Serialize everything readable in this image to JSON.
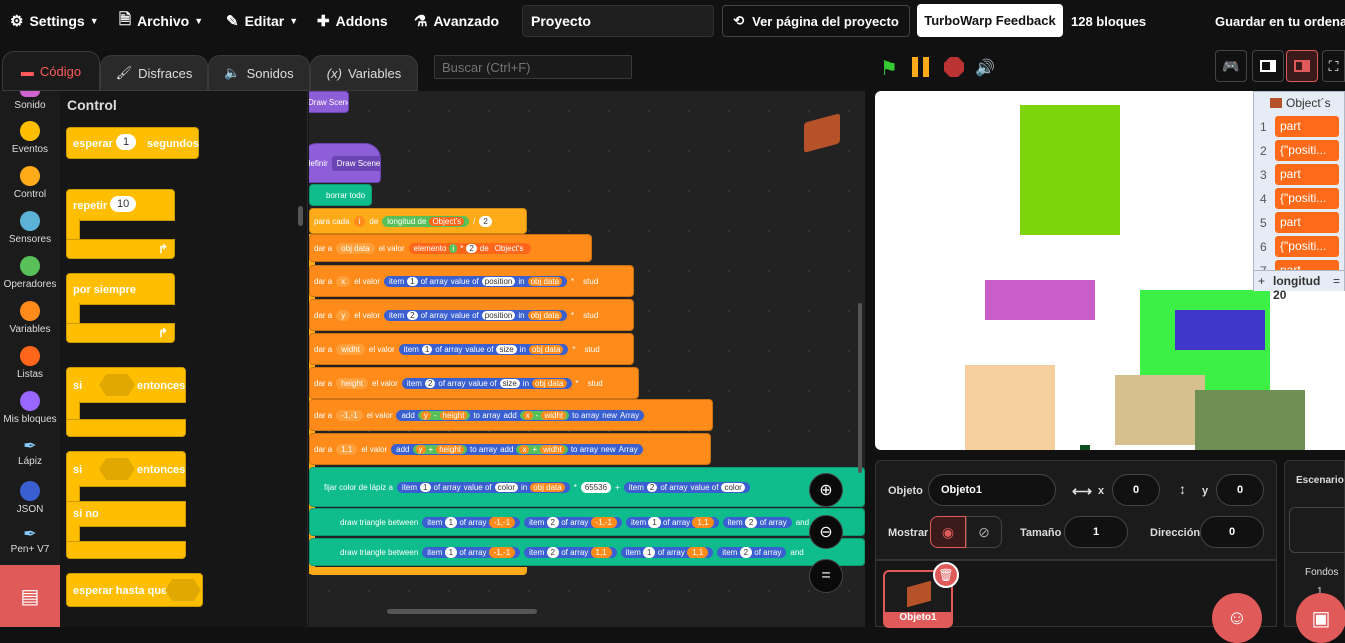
{
  "menu": {
    "settings": "Settings",
    "file": "Archivo",
    "edit": "Editar",
    "addons": "Addons",
    "advanced": "Avanzado",
    "project_title": "Proyecto",
    "see_project": "Ver página del proyecto",
    "feedback": "TurboWarp Feedback",
    "block_count": "128 bloques",
    "save": "Guardar en tu ordenado"
  },
  "tabs": {
    "code": "Código",
    "costumes": "Disfraces",
    "sounds": "Sonidos",
    "variables": "Variables"
  },
  "search": {
    "placeholder": "Buscar (Ctrl+F)"
  },
  "categories": [
    {
      "label": "Sonido",
      "color": "#cf63cf"
    },
    {
      "label": "Eventos",
      "color": "#ffbf00"
    },
    {
      "label": "Control",
      "color": "#ffab19"
    },
    {
      "label": "Sensores",
      "color": "#5cb1d6"
    },
    {
      "label": "Operadores",
      "color": "#59c059"
    },
    {
      "label": "Variables",
      "color": "#ff8c1a"
    },
    {
      "label": "Listas",
      "color": "#ff661a"
    },
    {
      "label": "Mis bloques",
      "color": "#9966ff"
    },
    {
      "label": "Lápiz",
      "color": "#0fbd8c"
    },
    {
      "label": "JSON",
      "color": "#3a5fd1"
    },
    {
      "label": "Pen+ V7",
      "color": "#0fbd8c"
    }
  ],
  "palette": {
    "heading": "Control",
    "wait": "esperar",
    "wait_value": "1",
    "wait_unit": "segundos",
    "repeat": "repetir",
    "repeat_value": "10",
    "forever": "por siempre",
    "if_then": "si",
    "then": "entonces",
    "if_else_if": "si",
    "if_else_then": "entonces",
    "else": "si no",
    "wait_until": "esperar hasta que"
  },
  "scripts": {
    "draw_scene_call": "Draw Scene",
    "define": "definir",
    "define_name": "Draw Scene",
    "clear": "borrar todo",
    "for_each": "para cada",
    "for_var": "i",
    "for_in": "de",
    "length_of": "longitud de",
    "list_obj": "Object's",
    "div": "/",
    "div_val": "2",
    "set": "dar a",
    "to_value": "el valor",
    "obj_data": "obj data",
    "element": "elemento",
    "i": "i",
    "mul": "*",
    "two": "2",
    "of": "de",
    "x": "x",
    "y": "y",
    "widht": "widht",
    "height": "height",
    "m11": "-1,-1",
    "p11": "1,1",
    "item": "item",
    "one": "1",
    "of_array": "of array",
    "value_of": "value of",
    "position": "position",
    "in": "in",
    "stud": "stud",
    "size": "size",
    "add": "add",
    "minus": "-",
    "plus": "+",
    "to_array": "to array",
    "new": "new",
    "array": "Array",
    "pen_color": "fijar color de lápiz a",
    "color": "color",
    "c65536": "65536",
    "draw_triangle": "draw triangle between",
    "and": "and"
  },
  "stage": {
    "list_title": "Object´s",
    "list_items": [
      {
        "n": "1",
        "v": "part"
      },
      {
        "n": "2",
        "v": "{\"positi..."
      },
      {
        "n": "3",
        "v": "part"
      },
      {
        "n": "4",
        "v": "{\"positi..."
      },
      {
        "n": "5",
        "v": "part"
      },
      {
        "n": "6",
        "v": "{\"positi..."
      },
      {
        "n": "7",
        "v": "part"
      }
    ],
    "list_plus": "+",
    "list_length": "longitud 20",
    "list_eq": "="
  },
  "sprite": {
    "object_label": "Objeto",
    "object_name": "Objeto1",
    "x_label": "x",
    "x_value": "0",
    "y_label": "y",
    "y_value": "0",
    "show_label": "Mostrar",
    "size_label": "Tamaño",
    "size_value": "1",
    "direction_label": "Dirección",
    "direction_value": "0",
    "thumb_name": "Objeto1"
  },
  "stage_panel": {
    "title": "Escenario",
    "backdrops": "Fondos",
    "backdrop_count": "1"
  }
}
